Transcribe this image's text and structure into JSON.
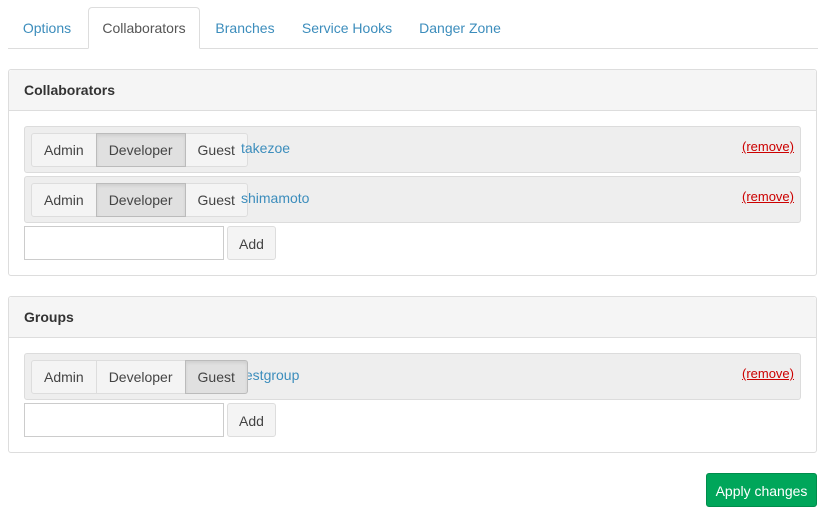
{
  "tabs": {
    "options": "Options",
    "collaborators": "Collaborators",
    "branches": "Branches",
    "service_hooks": "Service Hooks",
    "danger_zone": "Danger Zone",
    "active": "Collaborators"
  },
  "collaborators_panel": {
    "title": "Collaborators",
    "rows": [
      {
        "name": "takezoe",
        "roles": [
          "Admin",
          "Developer",
          "Guest"
        ],
        "selected_role": "Developer",
        "remove_label": "(remove)"
      },
      {
        "name": "shimamoto",
        "roles": [
          "Admin",
          "Developer",
          "Guest"
        ],
        "selected_role": "Developer",
        "remove_label": "(remove)"
      }
    ],
    "add_input_value": "",
    "add_label": "Add"
  },
  "groups_panel": {
    "title": "Groups",
    "rows": [
      {
        "name": "testgroup",
        "roles": [
          "Admin",
          "Developer",
          "Guest"
        ],
        "selected_role": "Guest",
        "remove_label": "(remove)"
      }
    ],
    "add_input_value": "",
    "add_label": "Add"
  },
  "apply_label": "Apply changes",
  "colors": {
    "link": "#3c8dbc",
    "remove": "#cc0000",
    "apply": "#00a65a",
    "panel_heading": "#f5f5f5",
    "row_bg": "#eeeeee"
  }
}
